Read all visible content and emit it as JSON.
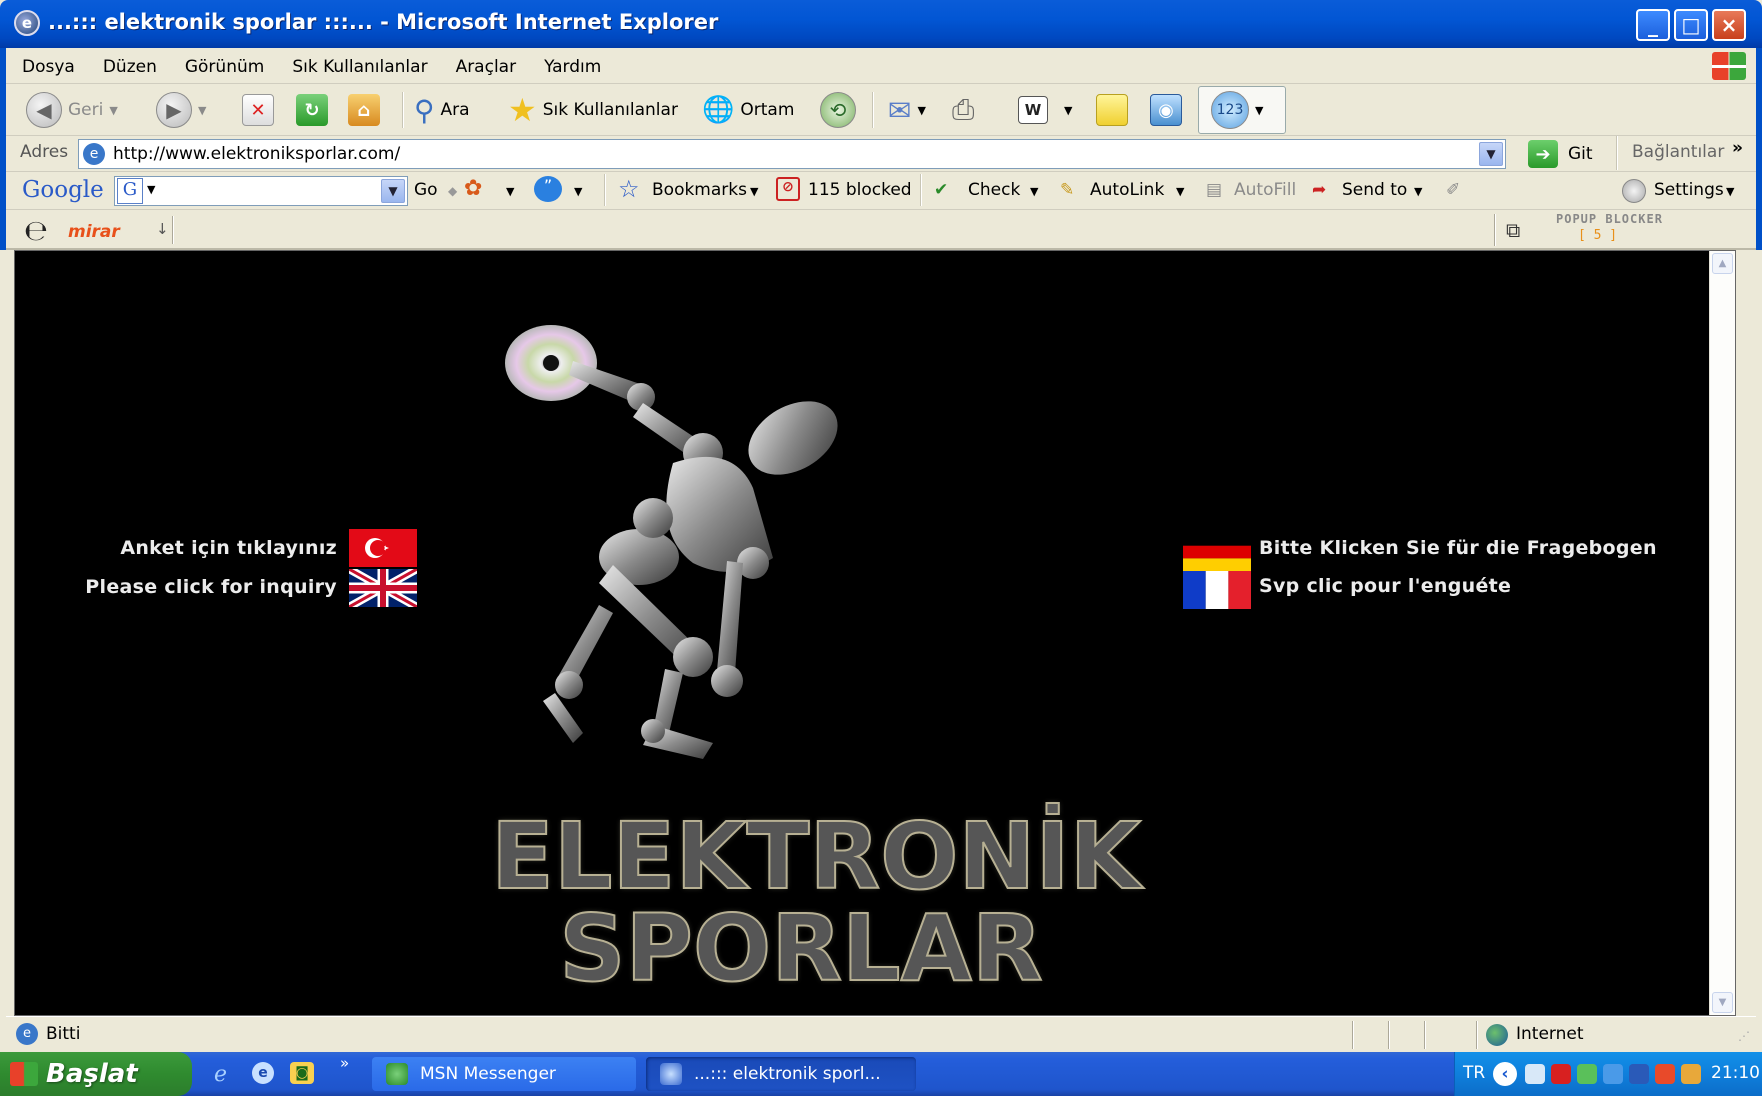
{
  "window": {
    "title": "...::: elektronik sporlar :::... - Microsoft Internet Explorer",
    "minimize": "_",
    "maximize": "□",
    "close": "×"
  },
  "menu": {
    "items": [
      "Dosya",
      "Düzen",
      "Görünüm",
      "Sık Kullanılanlar",
      "Araçlar",
      "Yardım"
    ]
  },
  "toolbar": {
    "back_label": "Geri",
    "search_label": "Ara",
    "favorites_label": "Sık Kullanılanlar",
    "media_label": "Ortam"
  },
  "address": {
    "label": "Adres",
    "url": "http://www.elektroniksporlar.com/",
    "go_label": "Git",
    "links_label": "Bağlantılar",
    "more": "»"
  },
  "google_toolbar": {
    "logo": "Google",
    "go_label": "Go",
    "bookmarks_label": "Bookmarks",
    "blocked_label": "115 blocked",
    "check_label": "Check",
    "autolink_label": "AutoLink",
    "autofill_label": "AutoFill",
    "sendto_label": "Send to",
    "settings_label": "Settings"
  },
  "mirar_toolbar": {
    "logo": "mirar",
    "popup_title": "POPUP BLOCKER",
    "popup_count": "[ 5 ]"
  },
  "page": {
    "links_left": [
      {
        "text": "Anket için tıklayınız",
        "flag": "turkey"
      },
      {
        "text": "Please click for inquiry",
        "flag": "uk"
      }
    ],
    "links_right": [
      {
        "text": "Bitte Klicken Sie für die Fragebogen",
        "flag": "germany"
      },
      {
        "text": "Svp clic pour l'enguéte",
        "flag": "france"
      }
    ],
    "logo_line1": "ELEKTRONİK",
    "logo_line2": "SPORLAR"
  },
  "statusbar": {
    "status": "Bitti",
    "zone": "Internet"
  },
  "taskbar": {
    "start_label": "Başlat",
    "tasks": [
      "MSN Messenger",
      "...::: elektronik sporl..."
    ],
    "lang": "TR",
    "clock": "21:10",
    "chevron": "»"
  },
  "colors": {
    "title_blue": "#0054e3",
    "start_green": "#3c9a3c",
    "page_bg": "#000000",
    "link_text": "#ececec"
  }
}
